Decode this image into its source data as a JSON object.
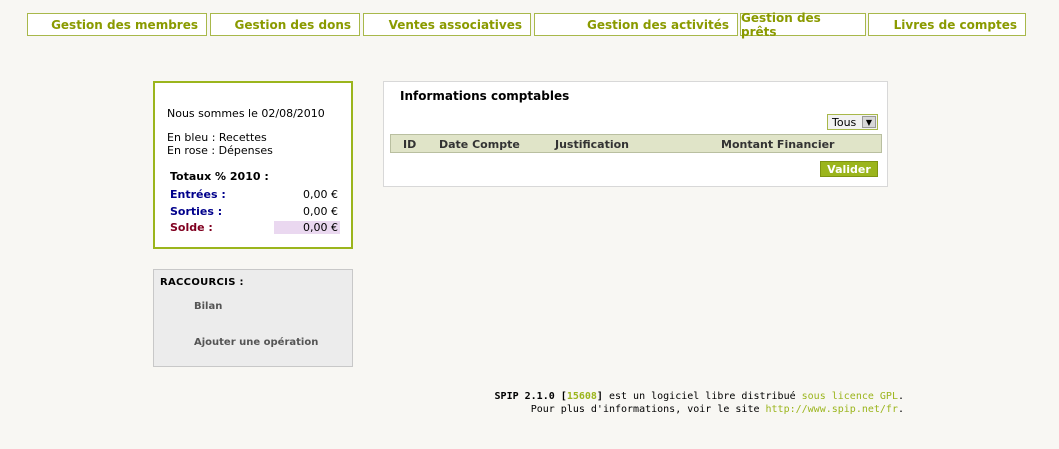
{
  "nav": [
    {
      "label": "Gestion des membres"
    },
    {
      "label": "Gestion des dons"
    },
    {
      "label": "Ventes associatives"
    },
    {
      "label": "Gestion des activités"
    },
    {
      "label": "Gestion des prêts"
    },
    {
      "label": "Livres de comptes"
    }
  ],
  "info": {
    "date_text": "Nous sommes le 02/08/2010",
    "legend_blue": "En bleu : Recettes",
    "legend_pink": "En rose : Dépenses",
    "totaux": "Totaux % 2010 :",
    "rows": [
      {
        "label": "Entrées :",
        "value": "0,00 €"
      },
      {
        "label": "Sorties :",
        "value": "0,00 €"
      },
      {
        "label": "Solde :",
        "value": "0,00 €"
      }
    ]
  },
  "shortcuts": {
    "title": "RACCOURCIS :",
    "items": [
      "Bilan",
      "Ajouter une opération"
    ]
  },
  "panel": {
    "title": "Informations comptables",
    "filter_value": "Tous",
    "columns": [
      "ID",
      "Date Compte",
      "Justification",
      "Montant Financier"
    ],
    "submit_label": "Valider"
  },
  "footer": {
    "spip": "SPIP 2.1.0",
    "bracket_open": "[",
    "revision": "15608",
    "bracket_close": "]",
    "text1": " est un logiciel libre distribué ",
    "licence": "sous licence GPL",
    "dot1": ".",
    "text2": "Pour plus d'informations, voir le site ",
    "site": "http://www.spip.net/fr",
    "dot2": "."
  },
  "colors": {
    "accent": "#9bb51c",
    "recettes": "#00008b",
    "depenses": "#800020"
  }
}
